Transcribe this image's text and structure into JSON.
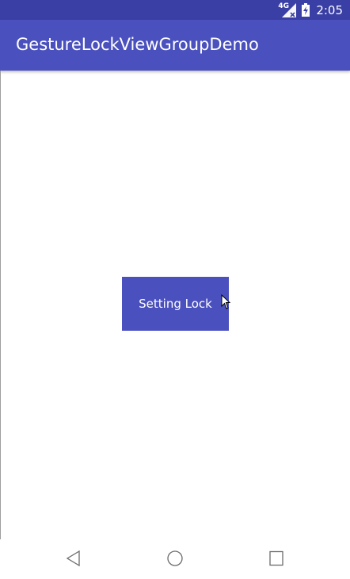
{
  "status_bar": {
    "network_label": "4G",
    "time": "2:05",
    "background_color": "#3a3fa5"
  },
  "app_bar": {
    "title": "GestureLockViewGroupDemo",
    "background_color": "#4a50bd"
  },
  "main": {
    "setting_button_label": "Setting Lock"
  },
  "icons": {
    "signal": "cellular-signal-icon",
    "battery": "battery-charging-icon",
    "cursor": "mouse-cursor-icon",
    "back": "nav-back-icon",
    "home": "nav-home-icon",
    "recents": "nav-recents-icon"
  }
}
